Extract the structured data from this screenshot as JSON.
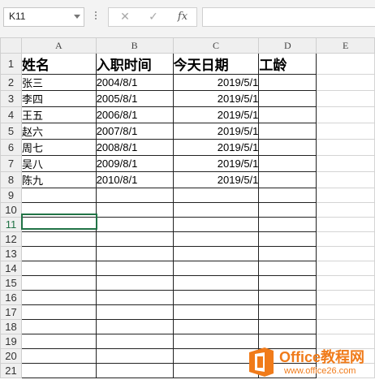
{
  "formula_bar": {
    "name_box": "K11",
    "cancel_glyph": "✕",
    "enter_glyph": "✓",
    "fx_label": "fx",
    "formula_value": ""
  },
  "columns": [
    "A",
    "B",
    "C",
    "D",
    "E"
  ],
  "rows": [
    {
      "num": "1",
      "cells": [
        "姓名",
        "入职时间",
        "今天日期",
        "工龄",
        ""
      ]
    },
    {
      "num": "2",
      "cells": [
        "张三",
        "2004/8/1",
        "2019/5/1",
        "",
        ""
      ]
    },
    {
      "num": "3",
      "cells": [
        "李四",
        "2005/8/1",
        "2019/5/1",
        "",
        ""
      ]
    },
    {
      "num": "4",
      "cells": [
        "王五",
        "2006/8/1",
        "2019/5/1",
        "",
        ""
      ]
    },
    {
      "num": "5",
      "cells": [
        "赵六",
        "2007/8/1",
        "2019/5/1",
        "",
        ""
      ]
    },
    {
      "num": "6",
      "cells": [
        "周七",
        "2008/8/1",
        "2019/5/1",
        "",
        ""
      ]
    },
    {
      "num": "7",
      "cells": [
        "吴八",
        "2009/8/1",
        "2019/5/1",
        "",
        ""
      ]
    },
    {
      "num": "8",
      "cells": [
        "陈九",
        "2010/8/1",
        "2019/5/1",
        "",
        ""
      ]
    },
    {
      "num": "9",
      "cells": [
        "",
        "",
        "",
        "",
        ""
      ]
    },
    {
      "num": "10",
      "cells": [
        "",
        "",
        "",
        "",
        ""
      ]
    },
    {
      "num": "11",
      "cells": [
        "",
        "",
        "",
        "",
        ""
      ]
    },
    {
      "num": "12",
      "cells": [
        "",
        "",
        "",
        "",
        ""
      ]
    },
    {
      "num": "13",
      "cells": [
        "",
        "",
        "",
        "",
        ""
      ]
    },
    {
      "num": "14",
      "cells": [
        "",
        "",
        "",
        "",
        ""
      ]
    },
    {
      "num": "15",
      "cells": [
        "",
        "",
        "",
        "",
        ""
      ]
    },
    {
      "num": "16",
      "cells": [
        "",
        "",
        "",
        "",
        ""
      ]
    },
    {
      "num": "17",
      "cells": [
        "",
        "",
        "",
        "",
        ""
      ]
    },
    {
      "num": "18",
      "cells": [
        "",
        "",
        "",
        "",
        ""
      ]
    },
    {
      "num": "19",
      "cells": [
        "",
        "",
        "",
        "",
        ""
      ]
    },
    {
      "num": "20",
      "cells": [
        "",
        "",
        "",
        "",
        ""
      ]
    },
    {
      "num": "21",
      "cells": [
        "",
        "",
        "",
        "",
        ""
      ]
    }
  ],
  "active_row": "11",
  "watermark": {
    "title": "Office教程网",
    "url": "www.office26.com",
    "accent": "#f07b1a",
    "icon": "office-logo-icon"
  },
  "colors": {
    "selection": "#217346"
  }
}
